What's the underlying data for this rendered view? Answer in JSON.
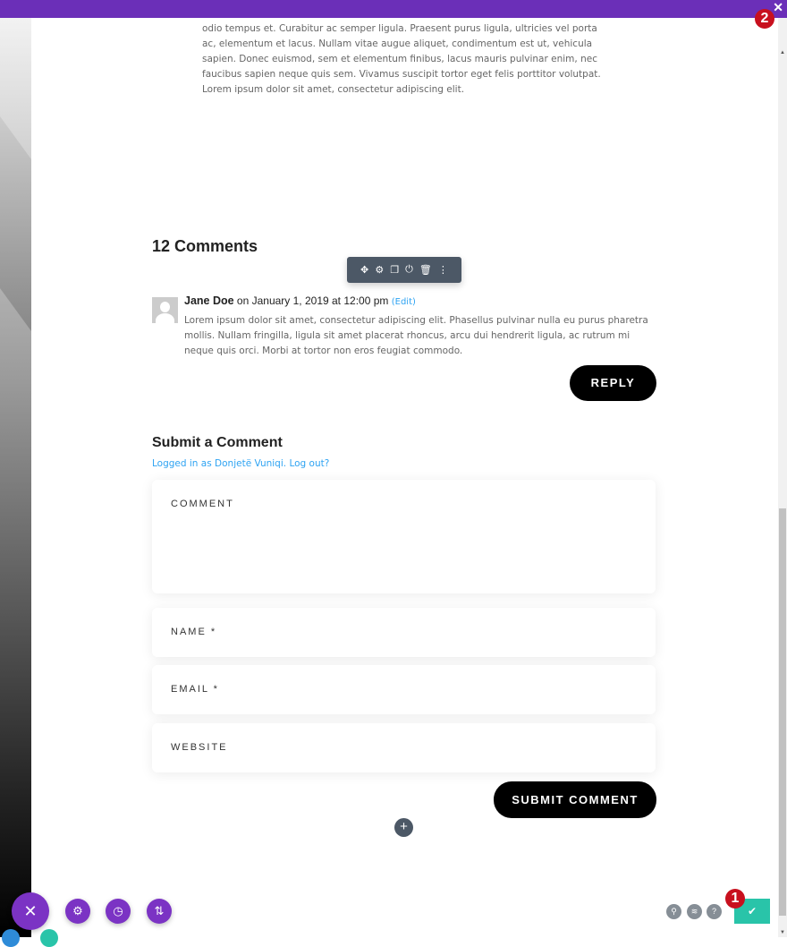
{
  "intro_text": "odio tempus et. Curabitur ac semper ligula. Praesent purus ligula, ultricies vel porta ac, elementum et lacus. Nullam vitae augue aliquet, condimentum est ut, vehicula sapien. Donec euismod, sem et elementum finibus, lacus mauris pulvinar enim, nec faucibus sapien neque quis sem. Vivamus suscipit tortor eget felis porttitor volutpat. Lorem ipsum dolor sit amet, consectetur adipiscing elit.",
  "comments": {
    "title": "12 Comments",
    "author": "Jane Doe",
    "date": " on January 1, 2019 at 12:00 pm ",
    "edit": "(Edit)",
    "body": "Lorem ipsum dolor sit amet, consectetur adipiscing elit. Phasellus pulvinar nulla eu purus pharetra mollis. Nullam fringilla, ligula sit amet placerat rhoncus, arcu dui hendrerit ligula, ac rutrum mi neque quis orci. Morbi at tortor non eros feugiat commodo.",
    "reply": "REPLY"
  },
  "form": {
    "title": "Submit a Comment",
    "logged_in": "Logged in as Donjetë Vuniqi. Log out?",
    "comment": "COMMENT",
    "name": "NAME *",
    "email": "EMAIL *",
    "website": "WEBSITE",
    "submit": "SUBMIT COMMENT"
  },
  "badges": {
    "one": "1",
    "two": "2"
  },
  "toolbar_icons": [
    "move-icon",
    "gear-icon",
    "duplicate-icon",
    "power-icon",
    "trash-icon",
    "more-icon"
  ],
  "colors": {
    "builder_purple": "#6b2fb8",
    "save_green": "#29c4a9",
    "link_blue": "#2ea3f2"
  }
}
